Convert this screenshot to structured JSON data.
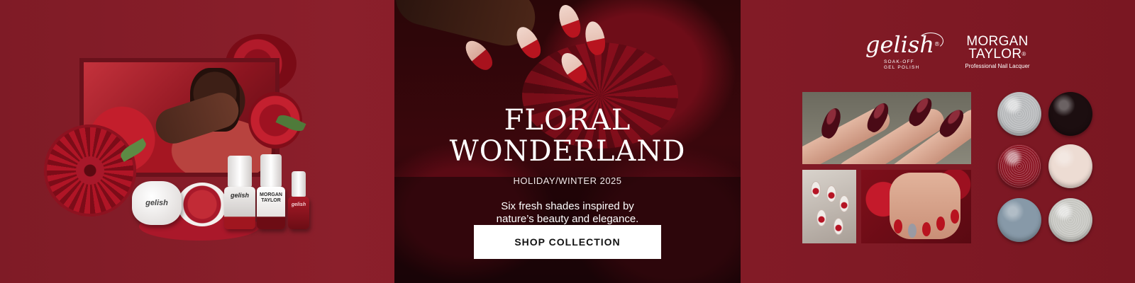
{
  "hero": {
    "headline_line1": "Floral",
    "headline_line2": "Wonderland",
    "season": "HOLIDAY/WINTER 2025",
    "tagline_line1": "Six fresh shades inspired by",
    "tagline_line2": "nature’s beauty and elegance.",
    "cta_label": "SHOP COLLECTION"
  },
  "brands": {
    "gelish": {
      "wordmark": "gelish",
      "registered": "®",
      "sub_line1": "SOAK-OFF",
      "sub_line2": "GEL POLISH"
    },
    "morgan_taylor": {
      "line1": "MORGAN",
      "line2": "TAYLOR",
      "registered": "®",
      "sub": "Professional Nail Lacquer"
    }
  },
  "products": {
    "jar_label": "gelish",
    "bottle1_label": "gelish",
    "bottle2_line1": "MORGAN",
    "bottle2_line2": "TAYLOR",
    "bottle3_label": "gelish"
  },
  "swatches": [
    {
      "name": "silver-glitter",
      "color": "#b7b9bb"
    },
    {
      "name": "black",
      "color": "#1c0e10"
    },
    {
      "name": "red-glitter",
      "color": "#8c1624"
    },
    {
      "name": "cream",
      "color": "#eddcd3"
    },
    {
      "name": "slate-blue",
      "color": "#8799a8"
    },
    {
      "name": "silver-shimmer",
      "color": "#c6c6c1"
    }
  ],
  "colors": {
    "background": "#7f1b26",
    "cta_background": "#ffffff",
    "cta_text": "#111111"
  }
}
